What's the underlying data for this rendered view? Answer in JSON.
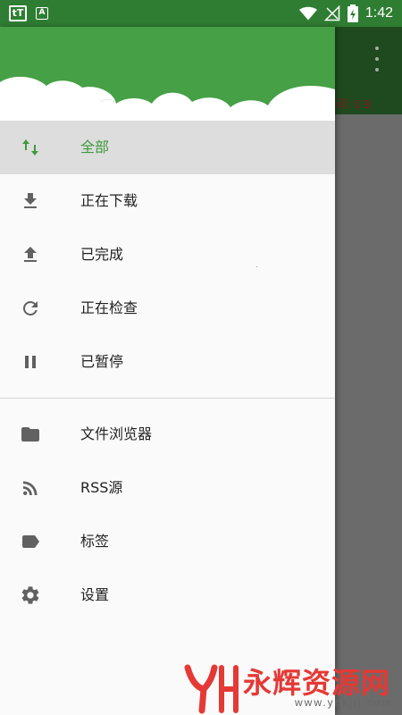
{
  "status_bar": {
    "app_icon_text": "tT",
    "a_icon_text": "A",
    "time": "1:42"
  },
  "background": {
    "speed_text": "间: 0 B"
  },
  "drawer": {
    "primary_items": [
      {
        "label": "全部",
        "icon": "swap-vert-icon",
        "selected": true
      },
      {
        "label": "正在下载",
        "icon": "download-icon"
      },
      {
        "label": "已完成",
        "icon": "upload-icon"
      },
      {
        "label": "正在检查",
        "icon": "refresh-icon"
      },
      {
        "label": "已暂停",
        "icon": "pause-icon"
      }
    ],
    "secondary_items": [
      {
        "label": "文件浏览器",
        "icon": "folder-icon"
      },
      {
        "label": "RSS源",
        "icon": "rss-icon"
      },
      {
        "label": "标签",
        "icon": "label-icon"
      },
      {
        "label": "设置",
        "icon": "gear-icon"
      }
    ]
  },
  "watermark": {
    "text": "永辉资源网",
    "url": "www.yhkjjj.com"
  },
  "colors": {
    "header_green": "#46a046",
    "status_green": "#2f7d32",
    "accent_green": "#3e9a3e",
    "icon_gray": "#616161"
  }
}
